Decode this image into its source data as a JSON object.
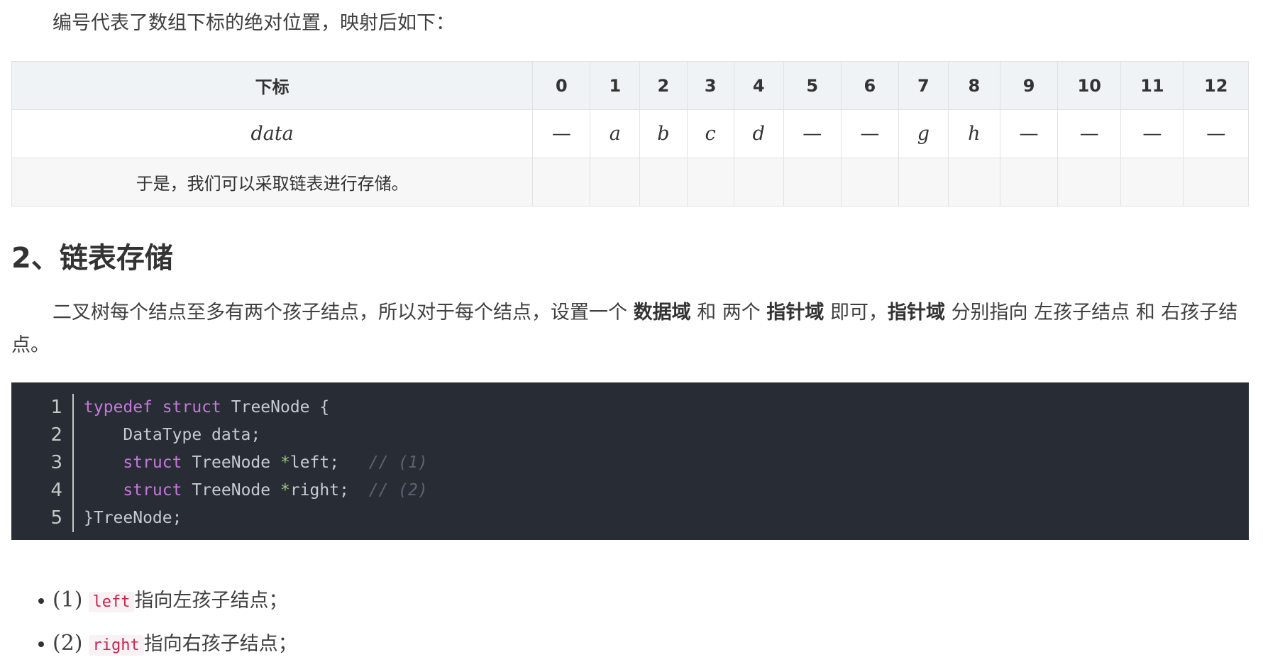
{
  "intro": "编号代表了数组下标的绝对位置，映射后如下：",
  "table": {
    "header_label": "下标",
    "indices": [
      "0",
      "1",
      "2",
      "3",
      "4",
      "5",
      "6",
      "7",
      "8",
      "9",
      "10",
      "11",
      "12"
    ],
    "data_label": "data",
    "data_values": [
      "—",
      "a",
      "b",
      "c",
      "d",
      "—",
      "—",
      "g",
      "h",
      "—",
      "—",
      "—",
      "—"
    ],
    "note": "于是，我们可以采取链表进行存储。"
  },
  "section_title": "2、链表存储",
  "paragraph": {
    "t1": "二叉树每个结点至多有两个孩子结点，所以对于每个结点，设置一个",
    "b1": "数据域",
    "t2": "和 两个",
    "b2": "指针域",
    "t3": "即可，",
    "b3": "指针域",
    "t4": "分别指向 左孩子结点 和 右孩子结点。"
  },
  "code": {
    "line_numbers": [
      "1",
      "2",
      "3",
      "4",
      "5"
    ],
    "l1_kw1": "typedef",
    "l1_kw2": "struct",
    "l1_rest": "TreeNode {",
    "l2": "    DataType data;",
    "l3_kw": "struct",
    "l3_type": "TreeNode",
    "l3_star": "*",
    "l3_var": "left;",
    "l3_cm": "// (1)",
    "l4_kw": "struct",
    "l4_type": "TreeNode",
    "l4_star": "*",
    "l4_var": "right;",
    "l4_cm": "// (2)",
    "l5": "}TreeNode;"
  },
  "bullets": [
    {
      "num": "(1)",
      "code": "left",
      "text": "指向左孩子结点；"
    },
    {
      "num": "(2)",
      "code": "right",
      "text": "指向右孩子结点；"
    }
  ]
}
